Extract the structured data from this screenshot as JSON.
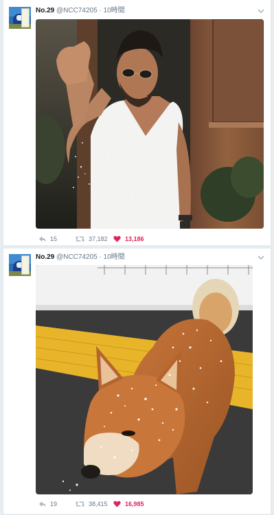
{
  "tweets": [
    {
      "name": "No.29",
      "handle": "@NCC74205",
      "separator": "·",
      "time": "10時間",
      "image": "man-sprinkling-salt-photo",
      "replies": "15",
      "retweets": "37,182",
      "likes": "13,186"
    },
    {
      "name": "No.29",
      "handle": "@NCC74205",
      "separator": "·",
      "time": "10時間",
      "image": "shiba-dog-in-snow-photo",
      "replies": "19",
      "retweets": "38,415",
      "likes": "16,985"
    }
  ],
  "icons": {
    "reply": "reply-icon",
    "retweet": "retweet-icon",
    "like": "heart-icon",
    "menu": "chevron-down-icon"
  },
  "colors": {
    "like": "#e0245e",
    "meta": "#657786",
    "background": "#e6ecf0"
  }
}
